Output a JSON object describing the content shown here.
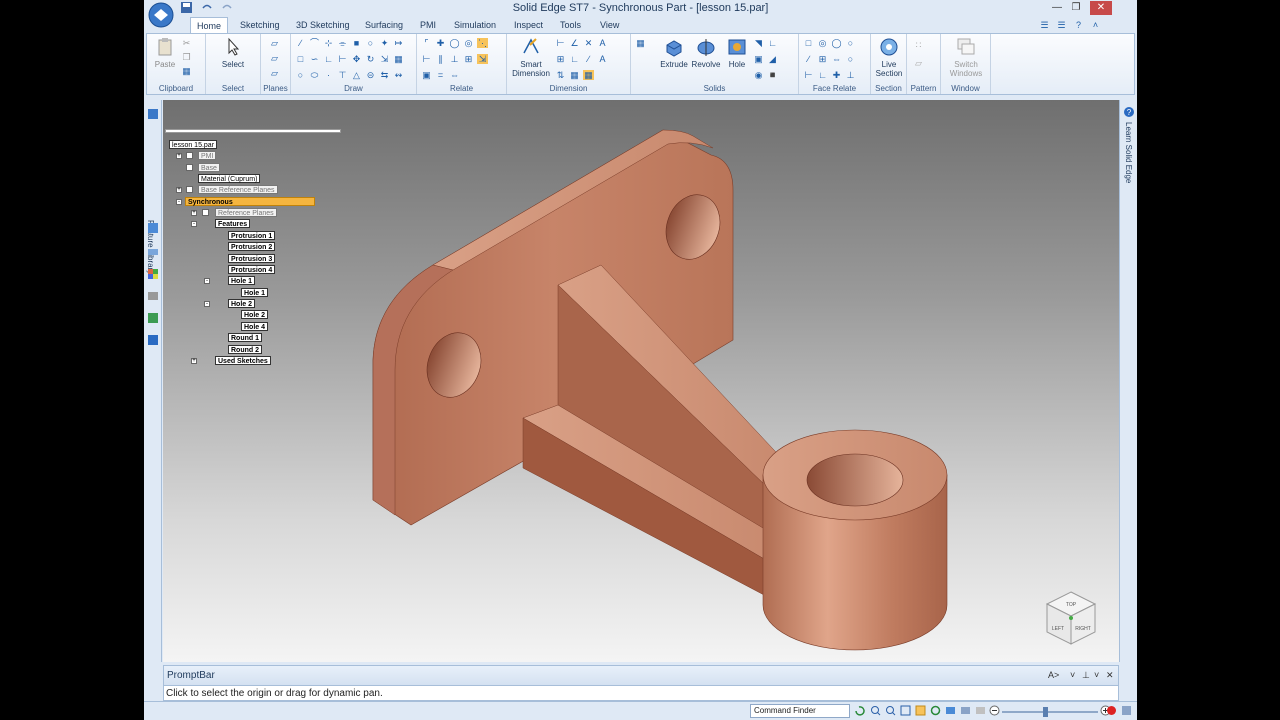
{
  "window": {
    "title": "Solid Edge ST7 - Synchronous Part - [lesson 15.par]"
  },
  "tabs": [
    "Home",
    "Sketching",
    "3D Sketching",
    "Surfacing",
    "PMI",
    "Simulation",
    "Inspect",
    "Tools",
    "View"
  ],
  "ribbon": {
    "groups": {
      "clipboard": "Clipboard",
      "select": "Select",
      "planes": "Planes",
      "draw": "Draw",
      "relate": "Relate",
      "dimension": "Dimension",
      "solids": "Solids",
      "face_relate": "Face Relate",
      "section": "Section",
      "pattern": "Pattern",
      "window": "Window"
    },
    "buttons": {
      "paste": "Paste",
      "select": "Select",
      "smart_dimension_1": "Smart",
      "smart_dimension_2": "Dimension",
      "extrude": "Extrude",
      "revolve": "Revolve",
      "hole": "Hole",
      "live_section_1": "Live",
      "live_section_2": "Section",
      "switch_windows_1": "Switch",
      "switch_windows_2": "Windows"
    }
  },
  "side_panels": {
    "left": "Feature Library",
    "right": "Learn Solid Edge"
  },
  "tree": {
    "root": "lesson 15.par",
    "pmi": "PMI",
    "base": "Base",
    "material": "Material (Cuprum)",
    "base_ref_planes": "Base Reference Planes",
    "synchronous": "Synchronous",
    "reference_planes": "Reference Planes",
    "features": "Features",
    "protrusion1": "Protrusion 1",
    "protrusion2": "Protrusion 2",
    "protrusion3": "Protrusion 3",
    "protrusion4": "Protrusion 4",
    "hole1": "Hole 1",
    "hole1_child": "Hole 1",
    "hole2": "Hole 2",
    "hole2_child": "Hole 2",
    "hole4": "Hole 4",
    "round1": "Round 1",
    "round2": "Round 2",
    "used_sketches": "Used Sketches"
  },
  "viewcube": {
    "top": "TOP",
    "left": "LEFT",
    "right": "RIGHT"
  },
  "promptbar": {
    "title": "PromptBar",
    "message": "Click to select the origin or drag for dynamic pan."
  },
  "statusbar": {
    "command_finder": "Command Finder"
  },
  "colors": {
    "copper": "#c98a6c",
    "ribbon_border": "#a7bed9",
    "selected_node": "#f5b53f"
  }
}
